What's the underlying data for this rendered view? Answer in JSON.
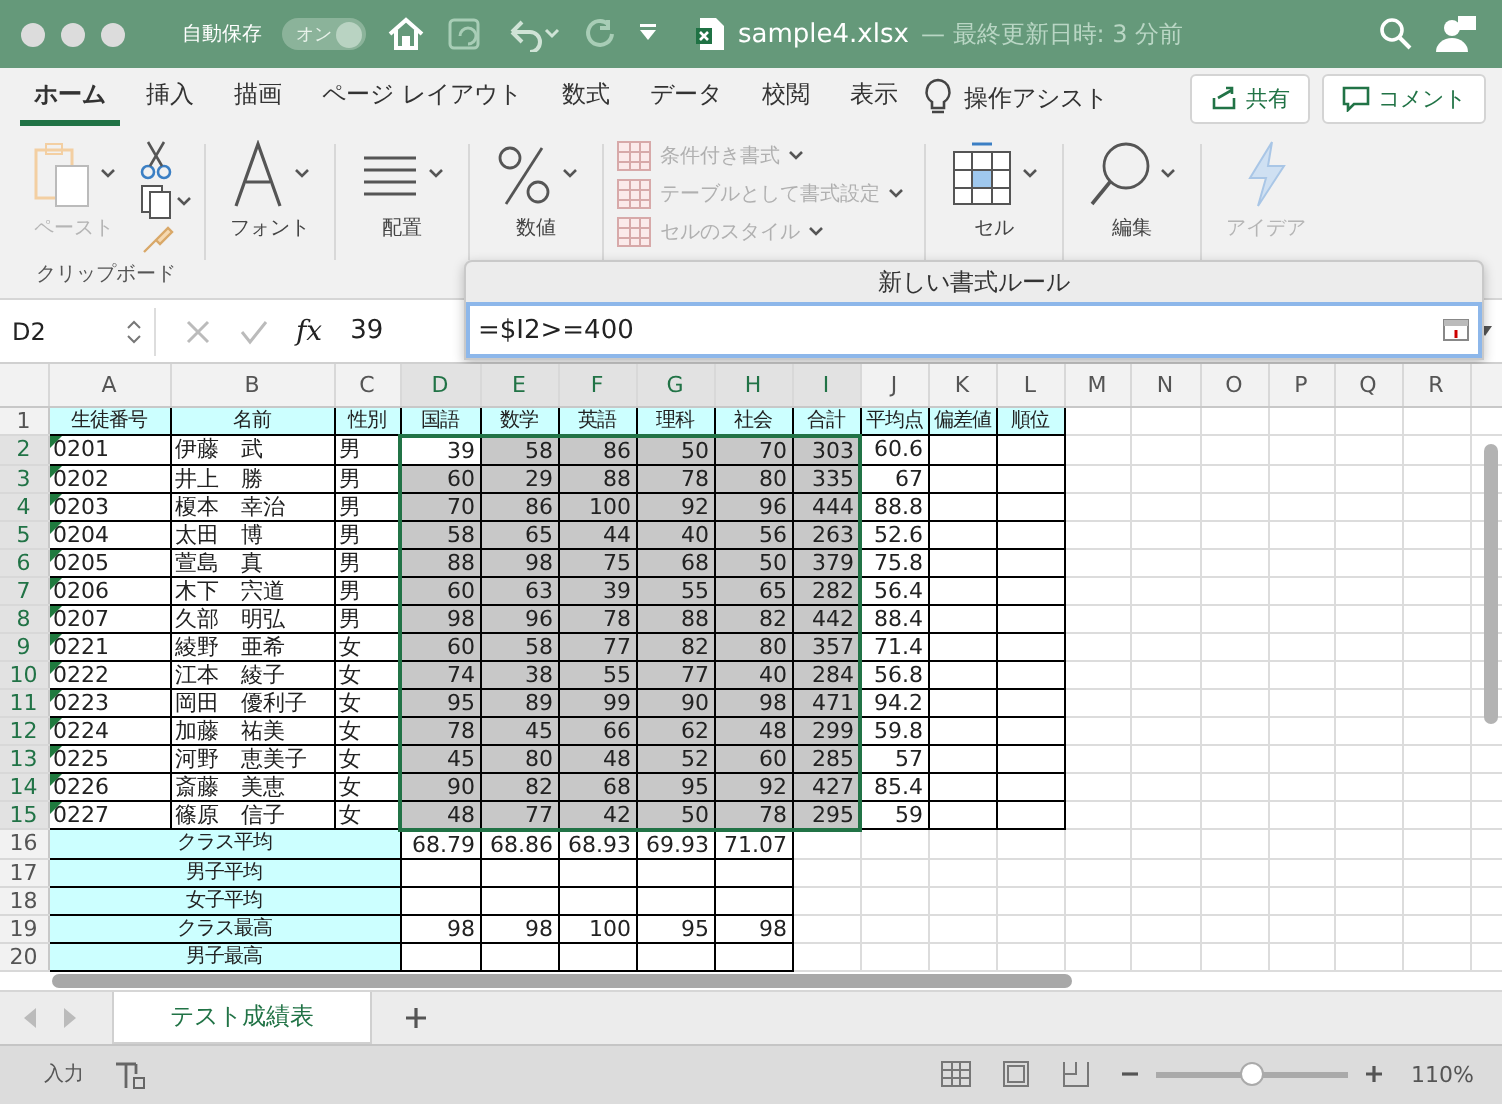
{
  "title_bar": {
    "autosave_label": "自動保存",
    "autosave_toggle": "オン",
    "autosave_on": true,
    "filename": "sample4.xlsx",
    "subtitle": "— 最終更新日時: 3 分前"
  },
  "ribbon_tabs": [
    {
      "label": "ホーム",
      "selected": true
    },
    {
      "label": "挿入",
      "selected": false
    },
    {
      "label": "描画",
      "selected": false
    },
    {
      "label": "ページ レイアウト",
      "selected": false
    },
    {
      "label": "数式",
      "selected": false
    },
    {
      "label": "データ",
      "selected": false
    },
    {
      "label": "校閲",
      "selected": false
    },
    {
      "label": "表示",
      "selected": false
    }
  ],
  "tell_me": "操作アシスト",
  "share_button": "共有",
  "comment_button": "コメント",
  "ribbon": {
    "paste": {
      "label": "ペースト",
      "disabled": true
    },
    "clipboard_group": "クリップボード",
    "font": "フォント",
    "alignment": "配置",
    "number": "数値",
    "styles": [
      {
        "label": "条件付き書式",
        "disabled": true
      },
      {
        "label": "テーブルとして書式設定",
        "disabled": true
      },
      {
        "label": "セルのスタイル",
        "disabled": true
      }
    ],
    "cells": "セル",
    "editing": "編集",
    "ideas": {
      "label": "アイデア",
      "disabled": true
    }
  },
  "formula_bar": {
    "name_box": "D2",
    "function_button": "fx",
    "formula": "39"
  },
  "rule_dialog": {
    "title": "新しい書式ルール",
    "value": "=$I2>=400"
  },
  "sheet": {
    "columns": [
      {
        "label": "A",
        "selected": false
      },
      {
        "label": "B",
        "selected": false
      },
      {
        "label": "C",
        "selected": false
      },
      {
        "label": "D",
        "selected": true
      },
      {
        "label": "E",
        "selected": true
      },
      {
        "label": "F",
        "selected": true
      },
      {
        "label": "G",
        "selected": true
      },
      {
        "label": "H",
        "selected": true
      },
      {
        "label": "I",
        "selected": true
      },
      {
        "label": "J",
        "selected": false
      },
      {
        "label": "K",
        "selected": false
      },
      {
        "label": "L",
        "selected": false
      },
      {
        "label": "M",
        "selected": false
      },
      {
        "label": "N",
        "selected": false
      },
      {
        "label": "O",
        "selected": false
      },
      {
        "label": "P",
        "selected": false
      },
      {
        "label": "Q",
        "selected": false
      },
      {
        "label": "R",
        "selected": false
      }
    ],
    "rows": [
      {
        "number": "1",
        "kind": "header",
        "selected": false,
        "cells": [
          "生徒番号",
          "名前",
          "性別",
          "国語",
          "数学",
          "英語",
          "理科",
          "社会",
          "合計",
          "平均点",
          "偏差値",
          "順位"
        ]
      },
      {
        "number": "2",
        "kind": "record",
        "selected": true,
        "flagged": true,
        "cells": [
          "0201",
          "伊藤　武",
          "男",
          "39",
          "58",
          "86",
          "50",
          "70",
          "303",
          "60.6"
        ]
      },
      {
        "number": "3",
        "kind": "record",
        "selected": true,
        "flagged": true,
        "cells": [
          "0202",
          "井上　勝",
          "男",
          "60",
          "29",
          "88",
          "78",
          "80",
          "335",
          "67"
        ]
      },
      {
        "number": "4",
        "kind": "record",
        "selected": true,
        "flagged": true,
        "cells": [
          "0203",
          "榎本　幸治",
          "男",
          "70",
          "86",
          "100",
          "92",
          "96",
          "444",
          "88.8"
        ]
      },
      {
        "number": "5",
        "kind": "record",
        "selected": true,
        "flagged": true,
        "cells": [
          "0204",
          "太田　博",
          "男",
          "58",
          "65",
          "44",
          "40",
          "56",
          "263",
          "52.6"
        ]
      },
      {
        "number": "6",
        "kind": "record",
        "selected": true,
        "flagged": true,
        "cells": [
          "0205",
          "萱島　真",
          "男",
          "88",
          "98",
          "75",
          "68",
          "50",
          "379",
          "75.8"
        ]
      },
      {
        "number": "7",
        "kind": "record",
        "selected": true,
        "flagged": true,
        "cells": [
          "0206",
          "木下　宍道",
          "男",
          "60",
          "63",
          "39",
          "55",
          "65",
          "282",
          "56.4"
        ]
      },
      {
        "number": "8",
        "kind": "record",
        "selected": true,
        "flagged": true,
        "cells": [
          "0207",
          "久部　明弘",
          "男",
          "98",
          "96",
          "78",
          "88",
          "82",
          "442",
          "88.4"
        ]
      },
      {
        "number": "9",
        "kind": "record",
        "selected": true,
        "flagged": true,
        "cells": [
          "0221",
          "綾野　亜希",
          "女",
          "60",
          "58",
          "77",
          "82",
          "80",
          "357",
          "71.4"
        ]
      },
      {
        "number": "10",
        "kind": "record",
        "selected": true,
        "flagged": true,
        "cells": [
          "0222",
          "江本　綾子",
          "女",
          "74",
          "38",
          "55",
          "77",
          "40",
          "284",
          "56.8"
        ]
      },
      {
        "number": "11",
        "kind": "record",
        "selected": true,
        "flagged": true,
        "cells": [
          "0223",
          "岡田　優利子",
          "女",
          "95",
          "89",
          "99",
          "90",
          "98",
          "471",
          "94.2"
        ]
      },
      {
        "number": "12",
        "kind": "record",
        "selected": true,
        "flagged": true,
        "cells": [
          "0224",
          "加藤　祐美",
          "女",
          "78",
          "45",
          "66",
          "62",
          "48",
          "299",
          "59.8"
        ]
      },
      {
        "number": "13",
        "kind": "record",
        "selected": true,
        "flagged": true,
        "cells": [
          "0225",
          "河野　恵美子",
          "女",
          "45",
          "80",
          "48",
          "52",
          "60",
          "285",
          "57"
        ]
      },
      {
        "number": "14",
        "kind": "record",
        "selected": true,
        "flagged": true,
        "cells": [
          "0226",
          "斎藤　美恵",
          "女",
          "90",
          "82",
          "68",
          "95",
          "92",
          "427",
          "85.4"
        ]
      },
      {
        "number": "15",
        "kind": "record",
        "selected": true,
        "flagged": true,
        "cells": [
          "0227",
          "篠原　信子",
          "女",
          "48",
          "77",
          "42",
          "50",
          "78",
          "295",
          "59"
        ]
      },
      {
        "number": "16",
        "kind": "summary",
        "selected": false,
        "label": "クラス平均",
        "values": [
          "68.79",
          "68.86",
          "68.93",
          "69.93",
          "71.07"
        ]
      },
      {
        "number": "17",
        "kind": "summary",
        "selected": false,
        "label": "男子平均",
        "values": []
      },
      {
        "number": "18",
        "kind": "summary",
        "selected": false,
        "label": "女子平均",
        "values": []
      },
      {
        "number": "19",
        "kind": "summary",
        "selected": false,
        "label": "クラス最高",
        "values": [
          "98",
          "98",
          "100",
          "95",
          "98"
        ]
      },
      {
        "number": "20",
        "kind": "summary",
        "selected": false,
        "label": "男子最高",
        "values": []
      }
    ]
  },
  "sheet_tabs": [
    {
      "label": "テスト成績表",
      "selected": true
    }
  ],
  "status_bar": {
    "mode": "入力",
    "zoom": {
      "level": 0.5,
      "reading": "110%"
    }
  }
}
